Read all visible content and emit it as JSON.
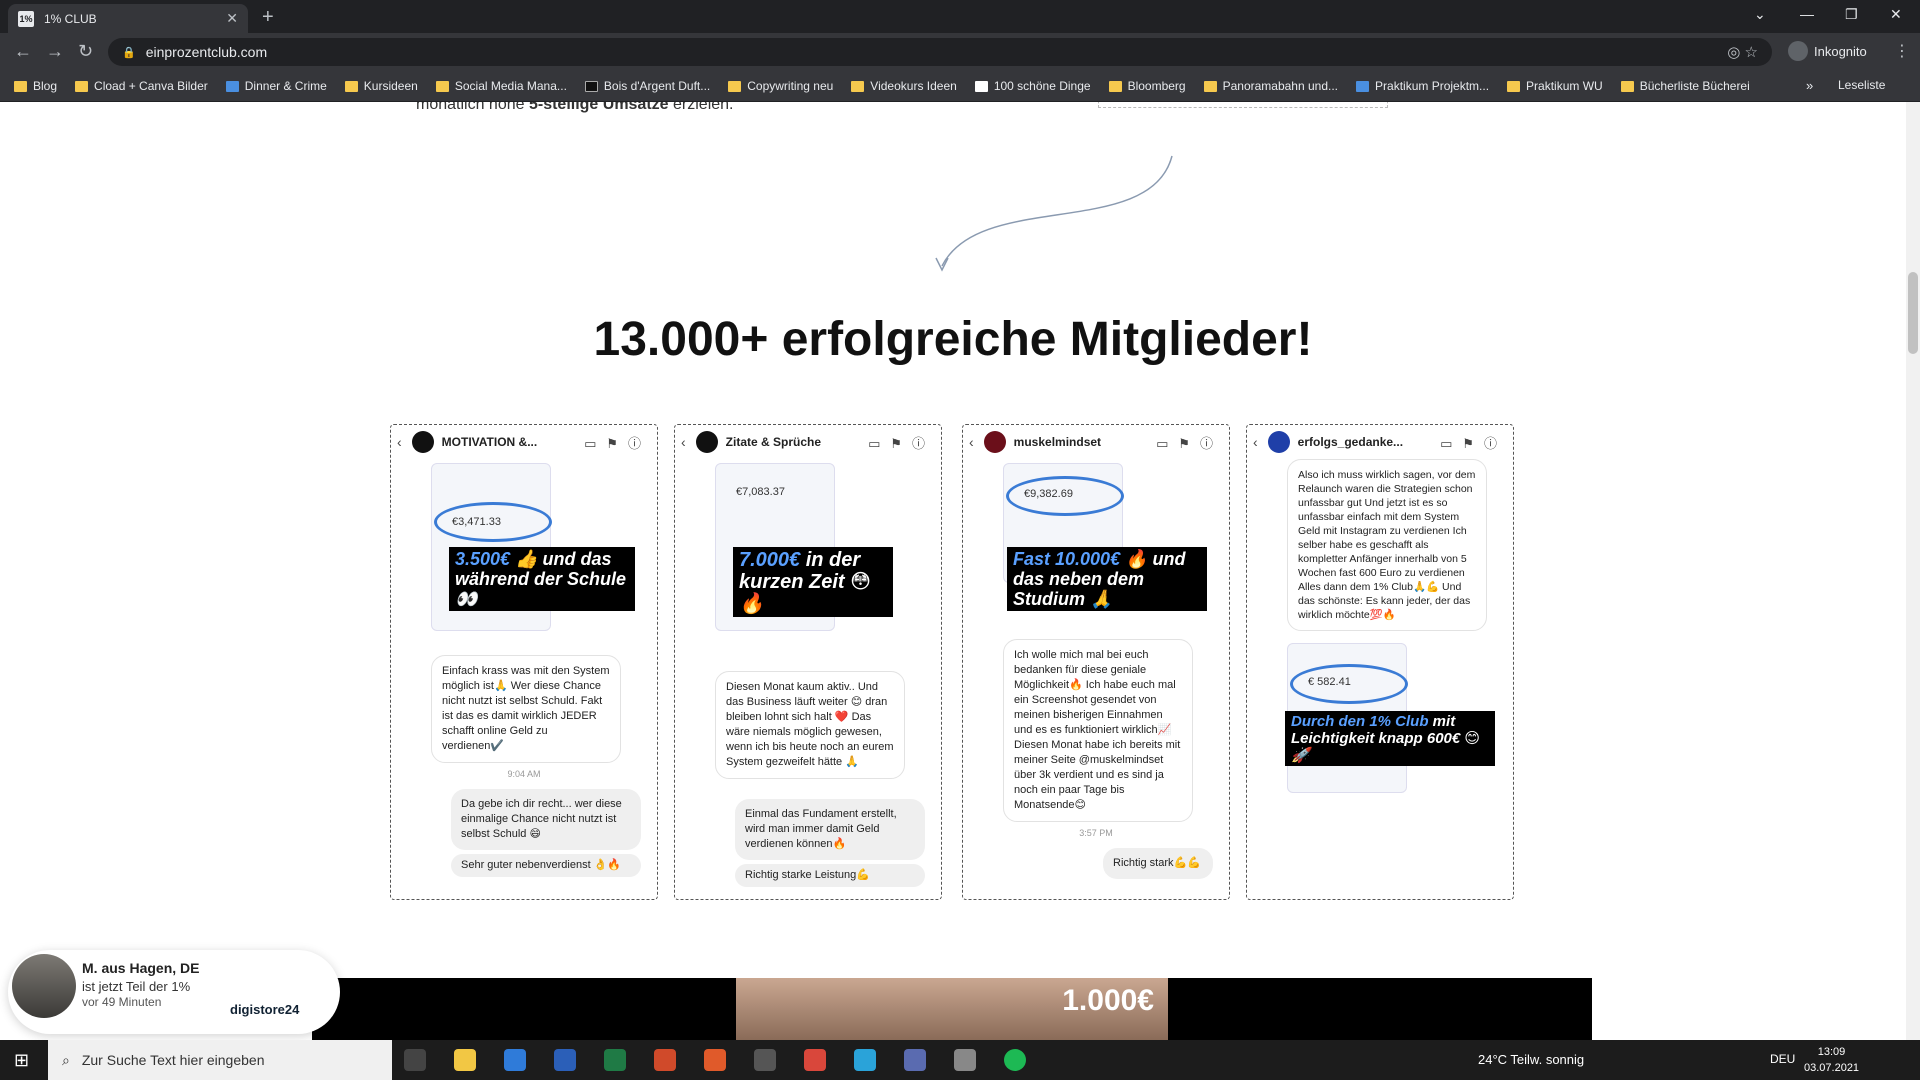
{
  "browser": {
    "tab_title": "1% CLUB",
    "url": "einprozentclub.com",
    "profile": "Inkognito",
    "bookmarks": [
      "Blog",
      "Cload + Canva Bilder",
      "Dinner & Crime",
      "Kursideen",
      "Social Media Mana...",
      "Bois d'Argent Duft...",
      "Copywriting neu",
      "Videokurs Ideen",
      "100 schöne Dinge",
      "Bloomberg",
      "Panoramabahn und...",
      "Praktikum Projektm...",
      "Praktikum WU",
      "Bücherliste Bücherei"
    ],
    "more": "»",
    "reading_list": "Leseliste"
  },
  "page": {
    "top_text_prefix": "monatlich hohe ",
    "top_text_bold": "5-stellige Umsätze",
    "top_text_suffix": " erzielen.",
    "headline": "13.000+ erfolgreiche Mitglieder!"
  },
  "cards": [
    {
      "account": "MOTIVATION &...",
      "amount": "€3,471.33",
      "banner_hl": "3.500€",
      "banner": " 👍 und das während der Schule 👀",
      "msg": "Einfach krass was mit den System möglich ist🙏 Wer diese Chance nicht nutzt ist selbst Schuld. Fakt ist das es damit wirklich JEDER schafft online Geld zu verdienen✔️",
      "time": "9:04 AM",
      "reply": "Da gebe ich dir recht... wer diese einmalige Chance nicht nutzt ist selbst Schuld 😄",
      "reply2": "Sehr guter nebenverdienst 👌🔥"
    },
    {
      "account": "Zitate & Sprüche",
      "amount": "€7,083.37",
      "banner_hl": "7.000€",
      "banner": " in der kurzen Zeit 😳🔥",
      "msg": "Diesen Monat kaum aktiv.. Und das Business läuft weiter 😊 dran bleiben lohnt sich halt ❤️ Das wäre niemals möglich gewesen, wenn ich bis heute noch an eurem System gezweifelt hätte 🙏",
      "time": "",
      "reply": "Einmal das Fundament erstellt, wird man immer damit Geld verdienen können🔥",
      "reply2": "Richtig starke Leistung💪"
    },
    {
      "account": "muskelmindset",
      "amount": "€9,382.69",
      "banner_hl": "Fast 10.000€",
      "banner": " 🔥 und das neben dem Studium 🙏",
      "msg": "Ich wolle mich mal bei euch bedanken für diese geniale Möglichkeit🔥 Ich habe euch mal ein Screenshot gesendet von meinen bisherigen Einnahmen und es es funktioniert wirklich📈 Diesen Monat habe ich bereits mit meiner Seite @muskelmindset über 3k verdient und es sind ja noch ein paar Tage bis Monatsende😊",
      "time": "3:57 PM",
      "reply": "Richtig stark💪💪",
      "reply2": ""
    },
    {
      "account": "erfolgs_gedanke...",
      "amount": "€ 582.41",
      "banner_hl": "Durch den 1% Club",
      "banner": " mit Leichtigkeit knapp 600€ 😊🚀",
      "msg": "Also ich muss wirklich sagen, vor dem Relaunch waren die Strategien schon unfassbar gut Und jetzt ist es so unfassbar einfach mit dem System Geld mit Instagram zu verdienen Ich selber habe es geschafft als kompletter Anfänger innerhalb von 5 Wochen fast 600 Euro zu verdienen Alles dann dem 1% Club🙏💪 Und das schönste: Es kann jeder, der das wirklich möchte💯🔥",
      "time": "",
      "reply": "",
      "reply2": ""
    }
  ],
  "notification": {
    "title": "M. aus Hagen, DE",
    "line1": "ist jetzt Teil der 1%",
    "line2": "vor 49 Minuten",
    "brand": "digistore24"
  },
  "video": {
    "price": "1.000€"
  },
  "taskbar": {
    "search_placeholder": "Zur Suche Text hier eingeben",
    "weather": "24°C  Teilw. sonnig",
    "lang": "DEU",
    "time": "13:09",
    "date": "03.07.2021"
  }
}
